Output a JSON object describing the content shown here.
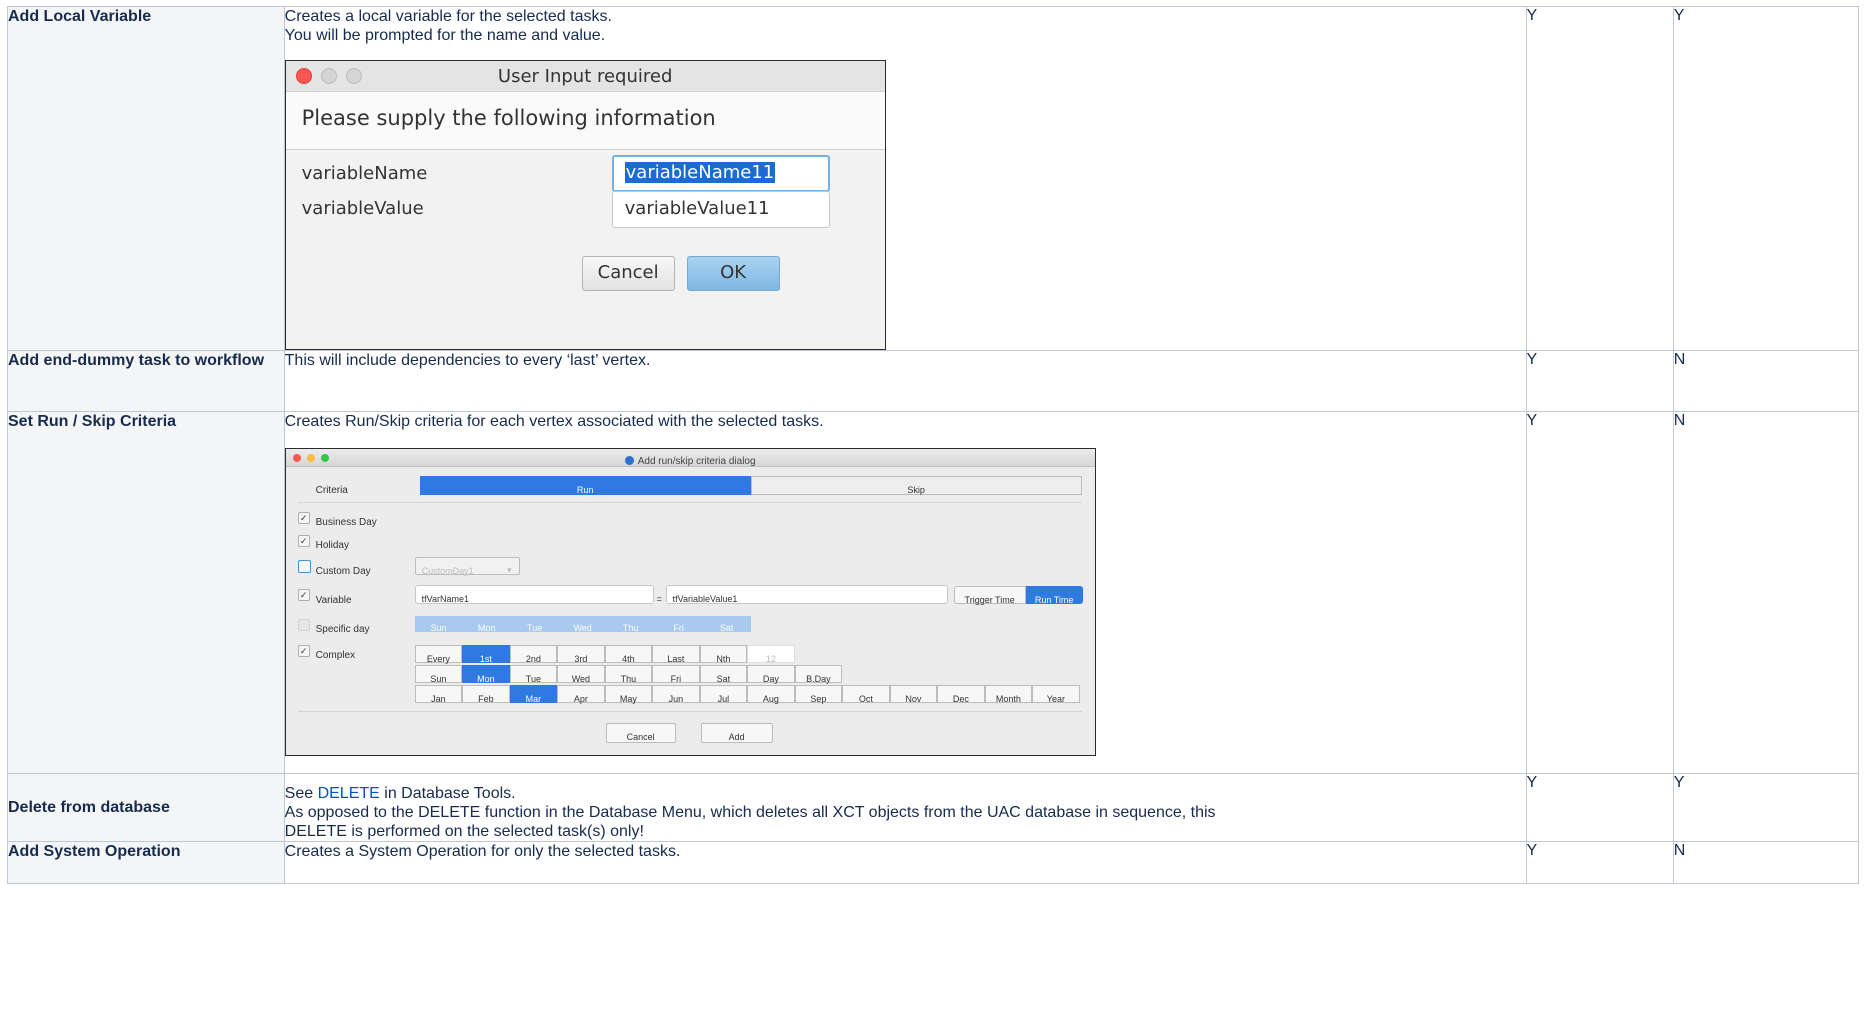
{
  "rows": [
    {
      "name": "Add Local Variable",
      "description": [
        "Creates a local variable for the selected tasks.",
        "You will be prompted for the name and value."
      ],
      "col3": "Y",
      "col4": "Y"
    },
    {
      "name": "Add end-dummy task to workflow",
      "description": [
        "This will include dependencies to every ‘last’ vertex."
      ],
      "col3": "Y",
      "col4": "N"
    },
    {
      "name": "Set Run / Skip Criteria",
      "description": [
        "Creates Run/Skip criteria for each vertex associated with the selected tasks."
      ],
      "col3": "Y",
      "col4": "N"
    },
    {
      "name": "Delete from database",
      "description_prefix": "See ",
      "description_link": "DELETE",
      "description_suffix": " in Database Tools.",
      "description_more": "As opposed to the DELETE function in the Database Menu, which deletes all XCT objects from the UAC database in sequence, this DELETE is performed on the selected task(s) only!",
      "col3": "Y",
      "col4": "Y"
    },
    {
      "name": "Add System Operation",
      "description": [
        "Creates a System Operation for only the selected tasks."
      ],
      "col3": "Y",
      "col4": "N"
    }
  ],
  "dialog1": {
    "title": "User Input required",
    "heading": "Please supply the following information",
    "name_label": "variableName",
    "name_value": "variableName11",
    "value_label": "variableValue",
    "value_value": "variableValue11",
    "cancel": "Cancel",
    "ok": "OK"
  },
  "dialog2": {
    "title": "Add run/skip criteria dialog",
    "criteria_label": "Criteria",
    "run": "Run",
    "skip": "Skip",
    "business_day": "Business Day",
    "holiday": "Holiday",
    "custom_day": "Custom Day",
    "custom_day_value": "CustomDay1",
    "variable": "Variable",
    "var_name": "tfVarName1",
    "equals": "=",
    "var_value": "tfVariableValue1",
    "trigger_time": "Trigger Time",
    "run_time": "Run Time",
    "specific_day": "Specific day",
    "specific_days": [
      "Sun",
      "Mon",
      "Tue",
      "Wed",
      "Thu",
      "Fri",
      "Sat"
    ],
    "complex": "Complex",
    "complex_row1": [
      "Every",
      "1st",
      "2nd",
      "3rd",
      "4th",
      "Last",
      "Nth"
    ],
    "complex_n": "12",
    "complex_row2": [
      "Sun",
      "Mon",
      "Tue",
      "Wed",
      "Thu",
      "Fri",
      "Sat",
      "Day",
      "B.Day"
    ],
    "complex_row3": [
      "Jan",
      "Feb",
      "Mar",
      "Apr",
      "May",
      "Jun",
      "Jul",
      "Aug",
      "Sep",
      "Oct",
      "Nov",
      "Dec",
      "Month",
      "Year"
    ],
    "selected": [
      "1st",
      "Mon",
      "Mar"
    ],
    "cancel": "Cancel",
    "add": "Add"
  }
}
